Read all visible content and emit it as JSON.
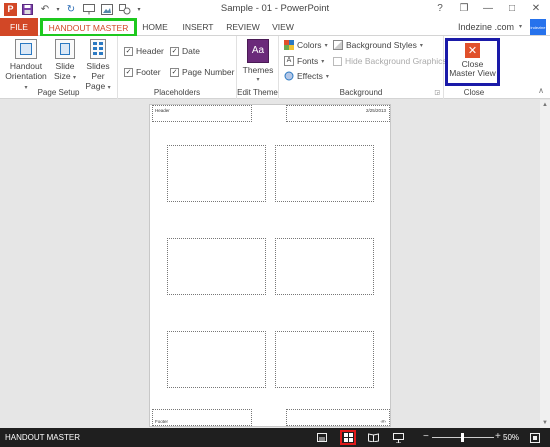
{
  "window": {
    "title": "Sample - 01 - PowerPoint",
    "controls": [
      "?",
      "❐",
      "—",
      "□",
      "✕"
    ]
  },
  "qat": {
    "logo": "P"
  },
  "tabs": {
    "file": "FILE",
    "active": "HANDOUT MASTER",
    "home": "HOME",
    "insert": "INSERT",
    "review": "REVIEW",
    "view": "VIEW"
  },
  "user": {
    "name": "Indezine .com",
    "avatar_text": "indezine"
  },
  "ribbon": {
    "page_setup": {
      "label": "Page Setup",
      "handout_orientation": [
        "Handout",
        "Orientation"
      ],
      "slide_size": [
        "Slide",
        "Size"
      ],
      "slides_per_page": [
        "Slides Per",
        "Page"
      ]
    },
    "placeholders": {
      "label": "Placeholders",
      "header": {
        "label": "Header",
        "checked": true
      },
      "date": {
        "label": "Date",
        "checked": true
      },
      "footer": {
        "label": "Footer",
        "checked": true
      },
      "page_number": {
        "label": "Page Number",
        "checked": true
      }
    },
    "edit_theme": {
      "label": "Edit Theme",
      "themes": "Themes",
      "themes_icon": "Aa"
    },
    "background": {
      "label": "Background",
      "colors": "Colors",
      "fonts": "Fonts",
      "effects": "Effects",
      "background_styles": "Background Styles",
      "hide_background_graphics": "Hide Background Graphics"
    },
    "close": {
      "label": "Close",
      "button": [
        "Close",
        "Master View"
      ]
    }
  },
  "handout": {
    "header": "Header",
    "date": "2/25/2013",
    "footer": "Footer",
    "page_number": "‹#›"
  },
  "status": {
    "left": "HANDOUT MASTER",
    "zoom": "50%"
  },
  "colors": {
    "accent": "#d24726",
    "active_tab_highlight": "#1ec81e",
    "close_highlight": "#1a1aa8",
    "status_highlight": "#e01a1a"
  }
}
